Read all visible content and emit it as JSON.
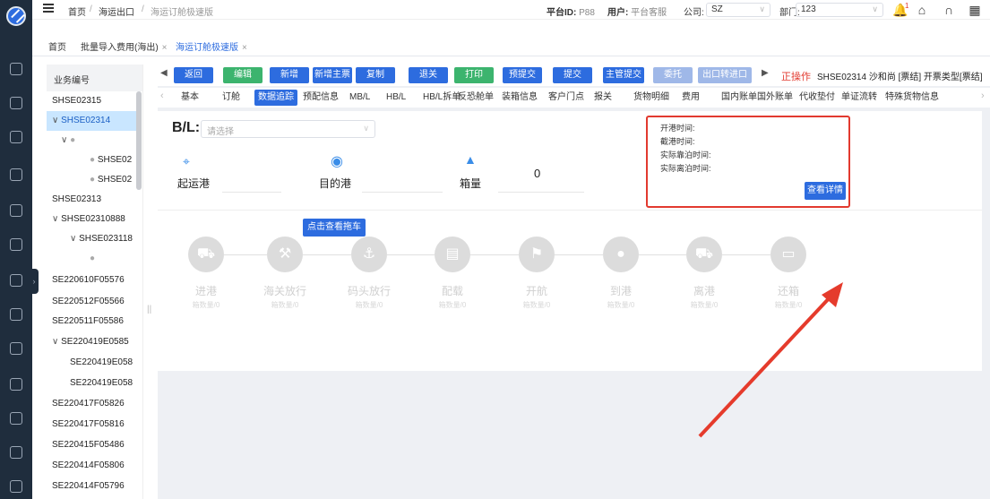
{
  "topbar": {
    "breadcrumb": [
      "首页",
      "海运出口",
      "海运订舱极速版"
    ],
    "platform_label": "平台ID:",
    "platform_value": "P88",
    "user_label": "用户:",
    "user_value": "平台客服",
    "company_label": "公司:",
    "company_value": "SZ",
    "dept_label": "部门:",
    "dept_value": "123",
    "bell_badge": "1"
  },
  "page_tabs": [
    {
      "label": "首页"
    },
    {
      "label": "批量导入费用(海出)"
    },
    {
      "label": "海运订舱极速版"
    }
  ],
  "sidebar": {
    "header": "业务编号",
    "items": [
      "SHSE02315",
      "SHSE02314",
      "",
      "SHSE02",
      "SHSE02",
      "SHSE02313",
      "SHSE02310888",
      "SHSE023118",
      "",
      "SE220610F05576",
      "SE220512F05566",
      "SE220511F05586",
      "SE220419E0585",
      "SE220419E058",
      "SE220419E058",
      "SE220417F05826",
      "SE220417F05816",
      "SE220415F05486",
      "SE220414F05806",
      "SE220414F05796"
    ]
  },
  "actions": {
    "buttons": [
      "返回",
      "编辑",
      "新增",
      "新增主票",
      "复制",
      "退关",
      "打印",
      "预提交",
      "提交",
      "主管提交",
      "委托",
      "出口转进口"
    ],
    "colors": [
      "#2d6cdf",
      "#3cb46e",
      "#2d6cdf",
      "#2d6cdf",
      "#2d6cdf",
      "#2d6cdf",
      "#3cb46e",
      "#2d6cdf",
      "#2d6cdf",
      "#2d6cdf",
      "#9fb8e8",
      "#9fb8e8"
    ],
    "status_label": "正操作",
    "status_info": "SHSE02314  沙和尚 [票结]  开票类型[票结]"
  },
  "detail_tabs": [
    "基本",
    "订舱",
    "数据追踪",
    "预配信息",
    "MB/L",
    "HB/L",
    "HB/L拆单",
    "反恐舱单",
    "装箱信息",
    "客户门点",
    "报关",
    "货物明细",
    "费用",
    "国内账单",
    "国外账单",
    "代收垫付",
    "单证流转",
    "特殊货物信息"
  ],
  "tracking": {
    "bl_label": "B/L:",
    "bl_placeholder": "请选择",
    "origin_label": "起运港",
    "dest_label": "目的港",
    "box_label": "箱量",
    "box_count": "0",
    "trailer_button": "点击查看拖车",
    "times": [
      "开港时间:",
      "截港时间:",
      "实际靠泊时间:",
      "实际离泊时间:"
    ],
    "detail_button": "查看详情",
    "steps": [
      {
        "label": "进港",
        "count": "箱数量/0"
      },
      {
        "label": "海关放行",
        "count": "箱数量/0"
      },
      {
        "label": "码头放行",
        "count": "箱数量/0"
      },
      {
        "label": "配载",
        "count": "箱数量/0"
      },
      {
        "label": "开航",
        "count": "箱数量/0"
      },
      {
        "label": "到港",
        "count": "箱数量/0"
      },
      {
        "label": "离港",
        "count": "箱数量/0"
      },
      {
        "label": "还箱",
        "count": "箱数量/0"
      }
    ]
  }
}
